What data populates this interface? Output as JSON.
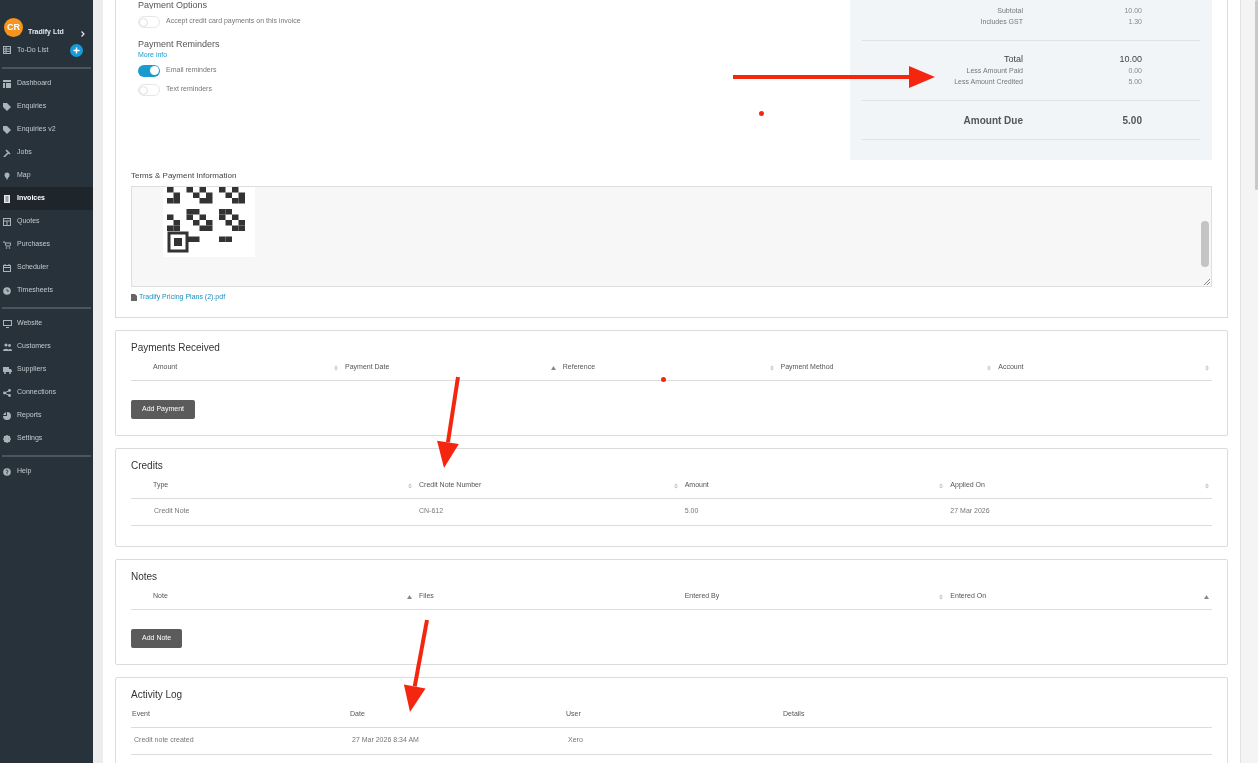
{
  "sidebar": {
    "account": {
      "initials": "CR",
      "name": "Tradify Ltd"
    },
    "todo": {
      "label": "To-Do List"
    },
    "groups": [
      [
        {
          "label": "Dashboard",
          "selected": false
        },
        {
          "label": "Enquiries",
          "selected": false
        },
        {
          "label": "Enquiries v2",
          "selected": false
        },
        {
          "label": "Jobs",
          "selected": false
        },
        {
          "label": "Map",
          "selected": false
        },
        {
          "label": "Invoices",
          "selected": true
        },
        {
          "label": "Quotes",
          "selected": false
        },
        {
          "label": "Purchases",
          "selected": false
        },
        {
          "label": "Scheduler",
          "selected": false
        },
        {
          "label": "Timesheets",
          "selected": false
        }
      ],
      [
        {
          "label": "Website",
          "selected": false
        },
        {
          "label": "Customers",
          "selected": false
        },
        {
          "label": "Suppliers",
          "selected": false
        },
        {
          "label": "Connections",
          "selected": false
        },
        {
          "label": "Reports",
          "selected": false
        },
        {
          "label": "Settings",
          "selected": false
        }
      ],
      [
        {
          "label": "Help",
          "selected": false
        }
      ]
    ]
  },
  "payment_options": {
    "title": "Payment Options",
    "toggles": [
      {
        "label": "Accept credit card payments on this invoice",
        "on": false
      }
    ]
  },
  "payment_reminders": {
    "title": "Payment Reminders",
    "link": "More info",
    "toggles": [
      {
        "label": "Email reminders",
        "on": true
      },
      {
        "label": "Text reminders",
        "on": false
      }
    ]
  },
  "summary": {
    "groups": [
      [
        {
          "label": "Subtotal",
          "value": "10.00",
          "kind": "minor"
        },
        {
          "label": "Includes GST",
          "value": "1.30",
          "kind": "minor"
        }
      ],
      [
        {
          "label": "Total",
          "value": "10.00",
          "kind": "total"
        },
        {
          "label": "Less Amount Paid",
          "value": "0.00",
          "kind": "minor"
        },
        {
          "label": "Less Amount Credited",
          "value": "5.00",
          "kind": "minor"
        }
      ],
      [
        {
          "label": "Amount Due",
          "value": "5.00",
          "kind": "due"
        }
      ]
    ]
  },
  "terms": {
    "title": "Terms & Payment Information",
    "attachment": "Tradify Pricing Plans (2).pdf"
  },
  "sections": [
    {
      "title": "Payments Received",
      "kind": "table",
      "columns": [
        {
          "label": "Amount",
          "sortable": true,
          "sorted": false
        },
        {
          "label": "Payment Date",
          "sortable": true,
          "sorted": true
        },
        {
          "label": "Reference",
          "sortable": true,
          "sorted": false
        },
        {
          "label": "Payment Method",
          "sortable": true,
          "sorted": false
        },
        {
          "label": "Account",
          "sortable": true,
          "sorted": false
        }
      ],
      "button": "Add Payment"
    },
    {
      "title": "Credits",
      "kind": "table",
      "columns": [
        {
          "label": "Type",
          "sortable": true,
          "sorted": false
        },
        {
          "label": "Credit Note Number",
          "sortable": true,
          "sorted": false
        },
        {
          "label": "Amount",
          "sortable": true,
          "sorted": false
        },
        {
          "label": "Applied On",
          "sortable": true,
          "sorted": false
        }
      ],
      "rows": [
        [
          "Credit Note",
          "CN-612",
          "5.00",
          "27 Mar 2026"
        ]
      ]
    },
    {
      "title": "Notes",
      "kind": "table",
      "columns": [
        {
          "label": "Note",
          "sortable": true,
          "sorted": true
        },
        {
          "label": "Files",
          "sortable": false
        },
        {
          "label": "Entered By",
          "sortable": true,
          "sorted": false
        },
        {
          "label": "Entered On",
          "sortable": true,
          "sorted": true
        }
      ],
      "button": "Add Note"
    },
    {
      "title": "Activity Log",
      "kind": "log",
      "columns": [
        {
          "label": "Event"
        },
        {
          "label": "Date"
        },
        {
          "label": "User"
        },
        {
          "label": "Details"
        }
      ],
      "rows": [
        [
          "Credit note created",
          "27 Mar 2026 8:34 AM",
          "Xero"
        ]
      ]
    }
  ]
}
